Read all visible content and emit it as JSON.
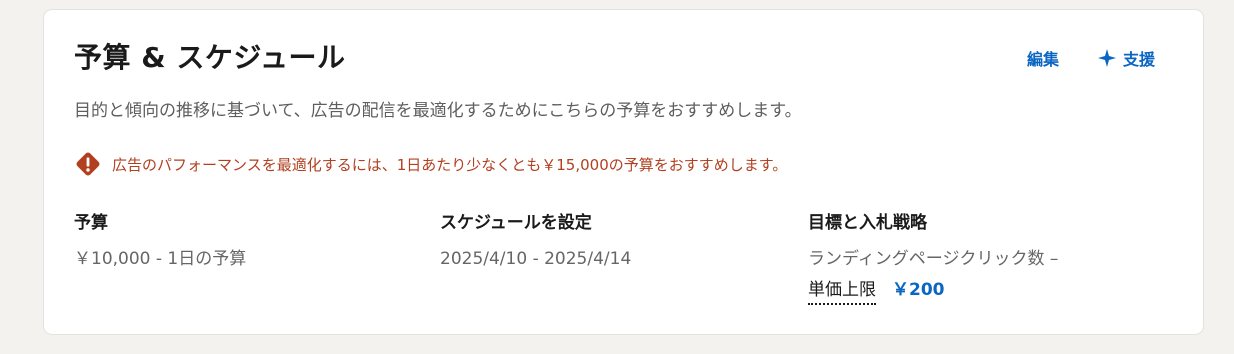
{
  "header": {
    "title": "予算 & スケジュール",
    "edit_label": "編集",
    "assist_label": "支援"
  },
  "subtitle": "目的と傾向の推移に基づいて、広告の配信を最適化するためにこちらの予算をおすすめします。",
  "warning": {
    "text": "広告のパフォーマンスを最適化するには、1日あたり少なくとも￥15,000の予算をおすすめします。",
    "color": "#b24020"
  },
  "columns": {
    "budget": {
      "label": "予算",
      "value": "￥10,000 - 1日の予算"
    },
    "schedule": {
      "label": "スケジュールを設定",
      "value": "2025/4/10 - 2025/4/14"
    },
    "strategy": {
      "label": "目標と入札戦略",
      "value": "ランディングページクリック数 –",
      "bid_cap_label": "単価上限",
      "bid_cap_value": "￥200"
    }
  },
  "colors": {
    "accent": "#0a66c2",
    "warning": "#b24020"
  },
  "icons": {
    "assist": "sparkle-icon",
    "warning": "warning-icon"
  }
}
